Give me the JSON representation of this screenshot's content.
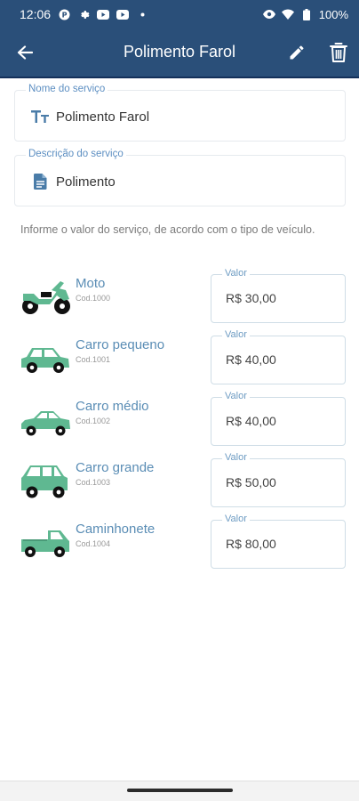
{
  "status_bar": {
    "time": "12:06",
    "battery": "100%"
  },
  "app_bar": {
    "title": "Polimento Farol",
    "back_icon": "arrow-left",
    "edit_icon": "pencil",
    "delete_icon": "trash"
  },
  "form": {
    "name_field": {
      "label": "Nome do serviço",
      "value": "Polimento Farol",
      "icon": "text-format-icon"
    },
    "description_field": {
      "label": "Descrição do serviço",
      "value": "Polimento",
      "icon": "document-icon"
    }
  },
  "info_text": "Informe o valor do serviço, de acordo com o tipo de veículo.",
  "vehicles": [
    {
      "name": "Moto",
      "code": "Cod.1000",
      "price_label": "Valor",
      "price": "R$ 30,00",
      "icon": "motorcycle"
    },
    {
      "name": "Carro pequeno",
      "code": "Cod.1001",
      "price_label": "Valor",
      "price": "R$ 40,00",
      "icon": "car-small"
    },
    {
      "name": "Carro médio",
      "code": "Cod.1002",
      "price_label": "Valor",
      "price": "R$ 40,00",
      "icon": "car-medium"
    },
    {
      "name": "Carro grande",
      "code": "Cod.1003",
      "price_label": "Valor",
      "price": "R$ 50,00",
      "icon": "car-large"
    },
    {
      "name": "Caminhonete",
      "code": "Cod.1004",
      "price_label": "Valor",
      "price": "R$ 80,00",
      "icon": "pickup-truck"
    }
  ],
  "colors": {
    "primary": "#2a4f79",
    "vehicle_green": "#5fb891",
    "label_blue": "#5d8fc2"
  }
}
